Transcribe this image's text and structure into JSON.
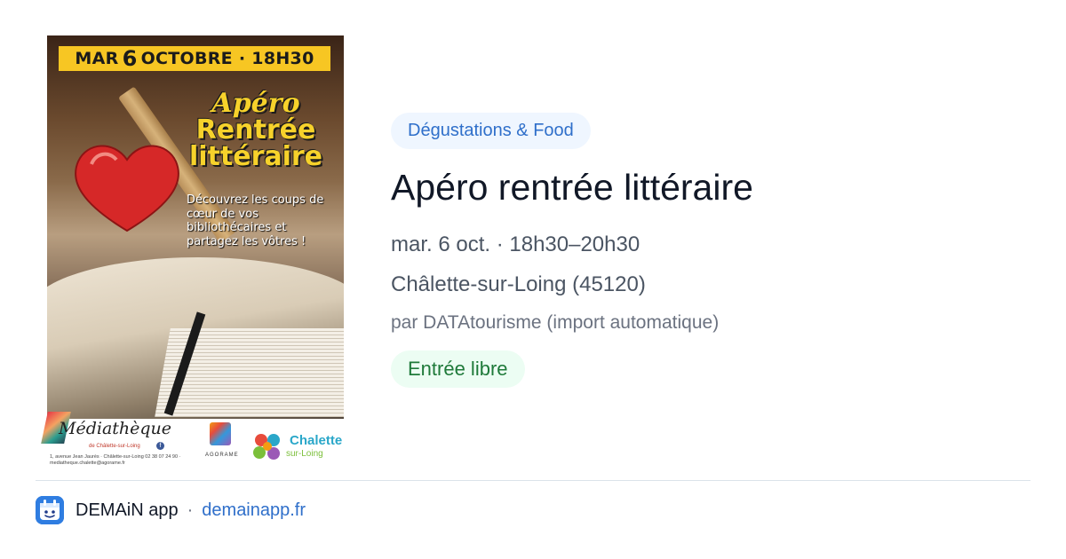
{
  "poster": {
    "date_prefix": "MAR",
    "date_day": "6",
    "date_suffix": "OCTOBRE · 18H30",
    "title_line1": "Apéro",
    "title_line2": "Rentrée",
    "title_line3": "littéraire",
    "subtitle": "Découvrez les coups de cœur de vos bibliothécaires et partagez les vôtres !",
    "logo_mediatheque": "Médiathèque",
    "logo_mediatheque_sub": "de Châlette-sur-Loing",
    "logo_mediatheque_address": "1, avenue Jean Jaurès · Châlette-sur-Loing 02 38 07 24 90 · mediatheque.chalette@agorame.fr",
    "logo_agorame": "AGORAME",
    "logo_chalette_1": "Chalette",
    "logo_chalette_2": "sur-Loing",
    "colors": {
      "banner": "#f7c623",
      "title": "#f7d22b",
      "heart": "#d62828"
    }
  },
  "event": {
    "category": "Dégustations & Food",
    "title": "Apéro rentrée littéraire",
    "datetime": "mar. 6 oct. · 18h30–20h30",
    "location": "Châlette-sur-Loing (45120)",
    "author": "par DATAtourisme (import automatique)",
    "price": "Entrée libre"
  },
  "footer": {
    "app_icon": "demain-app-icon",
    "app_name": "DEMAiN app",
    "separator": "·",
    "site": "demainapp.fr"
  },
  "colors": {
    "category_bg": "#eff6ff",
    "category_text": "#2f6fca",
    "price_bg": "#ecfdf3",
    "price_text": "#1f7a3a",
    "link": "#2f6fca"
  }
}
